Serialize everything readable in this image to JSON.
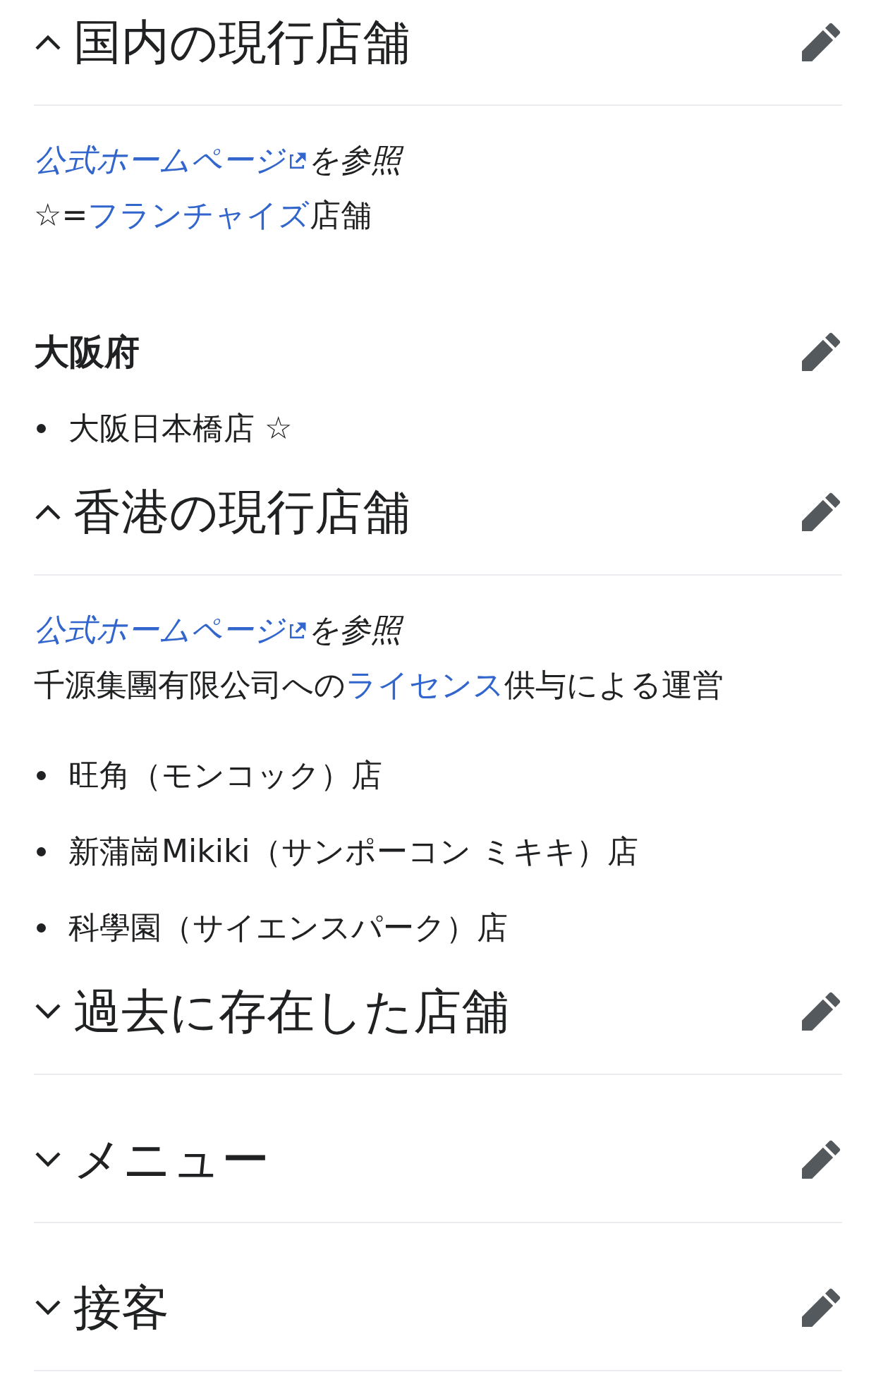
{
  "sections": [
    {
      "title": "国内の現行店舗",
      "expanded": true,
      "notes": [
        {
          "kind": "reference",
          "parts": [
            {
              "kind": "external-link",
              "text": "公式ホームページ"
            },
            {
              "kind": "text",
              "text": "を参照"
            }
          ]
        },
        {
          "kind": "plain",
          "parts": [
            {
              "kind": "text",
              "text": "☆="
            },
            {
              "kind": "link",
              "text": "フランチャイズ"
            },
            {
              "kind": "text",
              "text": "店舗"
            }
          ]
        }
      ],
      "subsections": [
        {
          "title": "大阪府",
          "items": [
            "大阪日本橋店 ☆"
          ]
        }
      ]
    },
    {
      "title": "香港の現行店舗",
      "expanded": true,
      "notes": [
        {
          "kind": "reference",
          "parts": [
            {
              "kind": "external-link",
              "text": "公式ホームページ"
            },
            {
              "kind": "text",
              "text": "を参照"
            }
          ]
        },
        {
          "kind": "plain",
          "parts": [
            {
              "kind": "text",
              "text": "千源集團有限公司への"
            },
            {
              "kind": "link",
              "text": "ライセンス"
            },
            {
              "kind": "text",
              "text": "供与による運営"
            }
          ]
        }
      ],
      "items": [
        "旺角（モンコック）店",
        "新蒲崗Mikiki（サンポーコン ミキキ）店",
        "科學園（サイエンスパーク）店"
      ]
    },
    {
      "title": "過去に存在した店舗",
      "expanded": false
    },
    {
      "title": "メニュー",
      "expanded": false
    },
    {
      "title": "接客",
      "expanded": false
    }
  ]
}
